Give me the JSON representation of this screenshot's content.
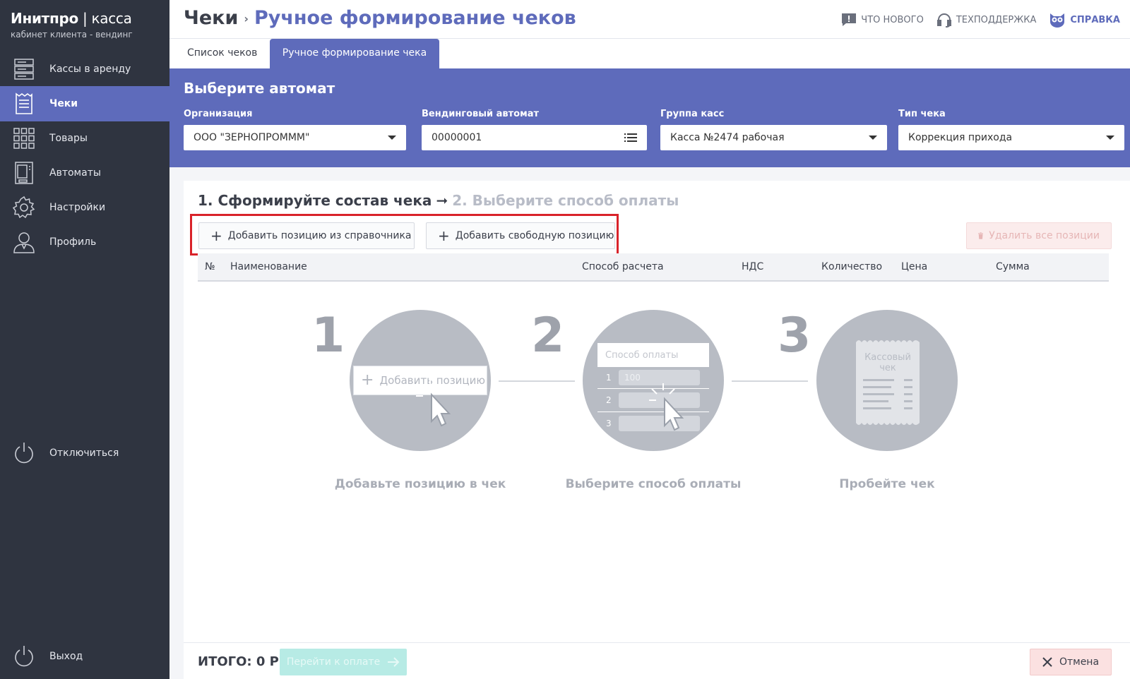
{
  "brand": {
    "name_bold": "Инитпро",
    "separator": " | ",
    "name_thin": "касса",
    "subtitle": "кабинет клиента - вендинг"
  },
  "sidebar": {
    "items": [
      {
        "label": "Кассы в аренду",
        "icon": "server-rack-icon"
      },
      {
        "label": "Чеки",
        "icon": "receipt-icon",
        "active": true
      },
      {
        "label": "Товары",
        "icon": "grid-icon"
      },
      {
        "label": "Автоматы",
        "icon": "vending-machine-icon"
      },
      {
        "label": "Настройки",
        "icon": "gear-icon"
      },
      {
        "label": "Профиль",
        "icon": "user-icon"
      }
    ],
    "disconnect": "Отключиться",
    "logout": "Выход"
  },
  "header": {
    "crumb_root": "Чеки",
    "crumb_sep": "›",
    "crumb_current": "Ручное формирование чеков",
    "links": {
      "whats_new": "ЧТО НОВОГО",
      "support": "ТЕХПОДДЕРЖКА",
      "help": "СПРАВКА"
    }
  },
  "tabs": [
    "Список чеков",
    "Ручное формирование чека"
  ],
  "selector": {
    "title": "Выберите автомат",
    "org_label": "Организация",
    "org_value": "ООО \"ЗЕРНОПРОМММ\"",
    "machine_label": "Вендинговый автомат",
    "machine_value": "00000001",
    "group_label": "Группа касс",
    "group_value": "Касса №2474 рабочая",
    "type_label": "Тип чека",
    "type_value": "Коррекция прихода"
  },
  "steps": {
    "step1": "1. Сформируйте состав чека",
    "arrow": "➞",
    "step2": "2. Выберите способ оплаты"
  },
  "buttons": {
    "add_from_catalog": "Добавить позицию из справочника",
    "add_free": "Добавить свободную позицию",
    "delete_all": "Удалить все позиции"
  },
  "table": {
    "columns": [
      "№",
      "Наименование",
      "Способ расчета",
      "НДС",
      "Количество",
      "Цена",
      "Сумма"
    ]
  },
  "illustration": {
    "n1": "1",
    "n2": "2",
    "n3": "3",
    "add_position_label": "Добавить позицию",
    "payment_method_label": "Способ оплаты",
    "row_numbers": [
      "1",
      "2",
      "3"
    ],
    "row1_value": "100",
    "receipt_label": "Кассовый чек",
    "captions": [
      "Добавьте позицию в чек",
      "Выберите способ оплаты",
      "Пробейте чек"
    ]
  },
  "footer": {
    "total": "ИТОГО: 0 Р",
    "pay": "Перейти к оплате",
    "cancel": "Отмена"
  },
  "colors": {
    "accent": "#5e6bbb",
    "sidebar": "#2f3440",
    "highlight": "#d9232a"
  }
}
